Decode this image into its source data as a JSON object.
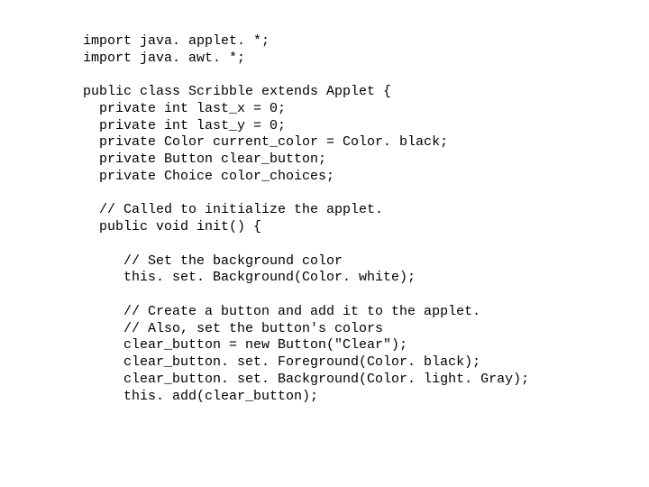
{
  "code": {
    "lines": [
      "import java. applet. *;",
      "import java. awt. *;",
      "",
      "public class Scribble extends Applet {",
      "  private int last_x = 0;",
      "  private int last_y = 0;",
      "  private Color current_color = Color. black;",
      "  private Button clear_button;",
      "  private Choice color_choices;",
      "",
      "  // Called to initialize the applet.",
      "  public void init() {",
      "",
      "     // Set the background color",
      "     this. set. Background(Color. white);",
      "",
      "     // Create a button and add it to the applet.",
      "     // Also, set the button's colors",
      "     clear_button = new Button(\"Clear\");",
      "     clear_button. set. Foreground(Color. black);",
      "     clear_button. set. Background(Color. light. Gray);",
      "     this. add(clear_button);"
    ]
  }
}
